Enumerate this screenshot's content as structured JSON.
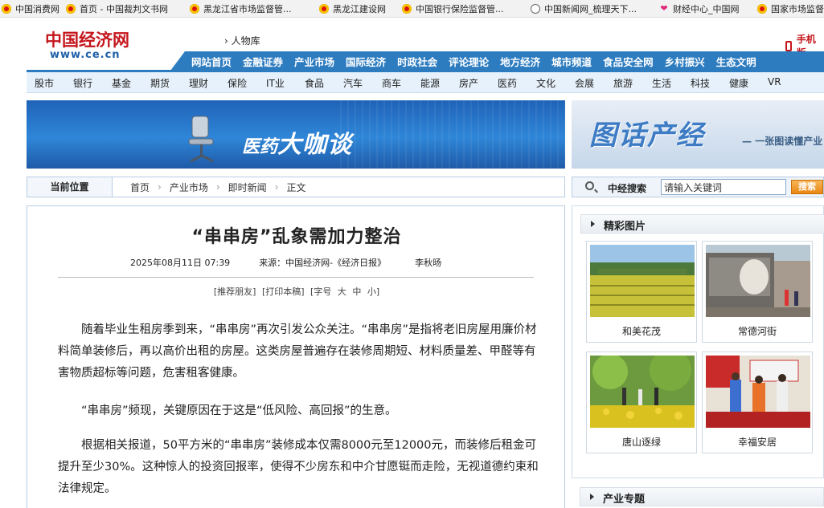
{
  "bookmarks": [
    {
      "label": "中国消费网",
      "icon": "emblem-icon"
    },
    {
      "label": "首页 - 中国裁判文书网",
      "icon": "emblem-icon"
    },
    {
      "label": "黑龙江省市场监督管...",
      "icon": "emblem-icon"
    },
    {
      "label": "黑龙江建设网",
      "icon": "emblem-icon"
    },
    {
      "label": "中国银行保险监督管...",
      "icon": "emblem-icon"
    },
    {
      "label": "中国新闻网_梳理天下...",
      "icon": "globe-icon"
    },
    {
      "label": "财经中心_中国网",
      "icon": "heart-icon"
    },
    {
      "label": "国家市场监督",
      "icon": "emblem-icon"
    }
  ],
  "header": {
    "logo_main": "中国经济网",
    "logo_url": "www.ce.cn",
    "people_link": "人物库",
    "mobile_link": "手机版"
  },
  "topnav": [
    "网站首页",
    "金融证券",
    "产业市场",
    "国际经济",
    "时政社会",
    "评论理论",
    "地方经济",
    "城市频道",
    "食品安全网",
    "乡村振兴",
    "生态文明"
  ],
  "subnav": [
    "股市",
    "银行",
    "基金",
    "期货",
    "理财",
    "保险",
    "IT业",
    "食品",
    "汽车",
    "商车",
    "能源",
    "房产",
    "医药",
    "文化",
    "会展",
    "旅游",
    "生活",
    "科技",
    "健康",
    "VR"
  ],
  "banners": {
    "left_a": "医药",
    "left_b": "大咖谈",
    "right_title": "图话产经",
    "right_sub": "一张图读懂产业"
  },
  "breadcrumb": {
    "label": "当前位置",
    "items": [
      "首页",
      "产业市场",
      "即时新闻",
      "正文"
    ]
  },
  "search": {
    "label": "中经搜索",
    "placeholder": "请输入关键词",
    "button": "搜索"
  },
  "article": {
    "title": "“串串房”乱象需加力整治",
    "date": "2025年08月11日 07:39",
    "source": "来源：中国经济网-《经济日报》",
    "author": "李秋旸",
    "tools": [
      "[推荐朋友]",
      "[打印本稿]",
      "[字号",
      "大",
      "中",
      "小]"
    ],
    "paragraphs": [
      "随着毕业生租房季到来，“串串房”再次引发公众关注。“串串房”是指将老旧房屋用廉价材料简单装修后，再以高价出租的房屋。这类房屋普遍存在装修周期短、材料质量差、甲醛等有害物质超标等问题，危害租客健康。",
      "“串串房”频现，关键原因在于这是“低风险、高回报”的生意。",
      "根据相关报道，50平方米的“串串房”装修成本仅需8000元至12000元，而装修后租金可提升至少30%。这种惊人的投资回报率，使得不少房东和中介甘愿铤而走险，无视道德约束和法律规定。"
    ]
  },
  "right": {
    "section1": "精彩图片",
    "pictures": [
      "和美花茂",
      "常德河街",
      "唐山逐绿",
      "幸福安居"
    ],
    "section2": "产业专题"
  },
  "colors": {
    "nav_blue": "#2d7cc0",
    "brand_red": "#c4161c",
    "subnav_bg": "#e6f1fb"
  }
}
